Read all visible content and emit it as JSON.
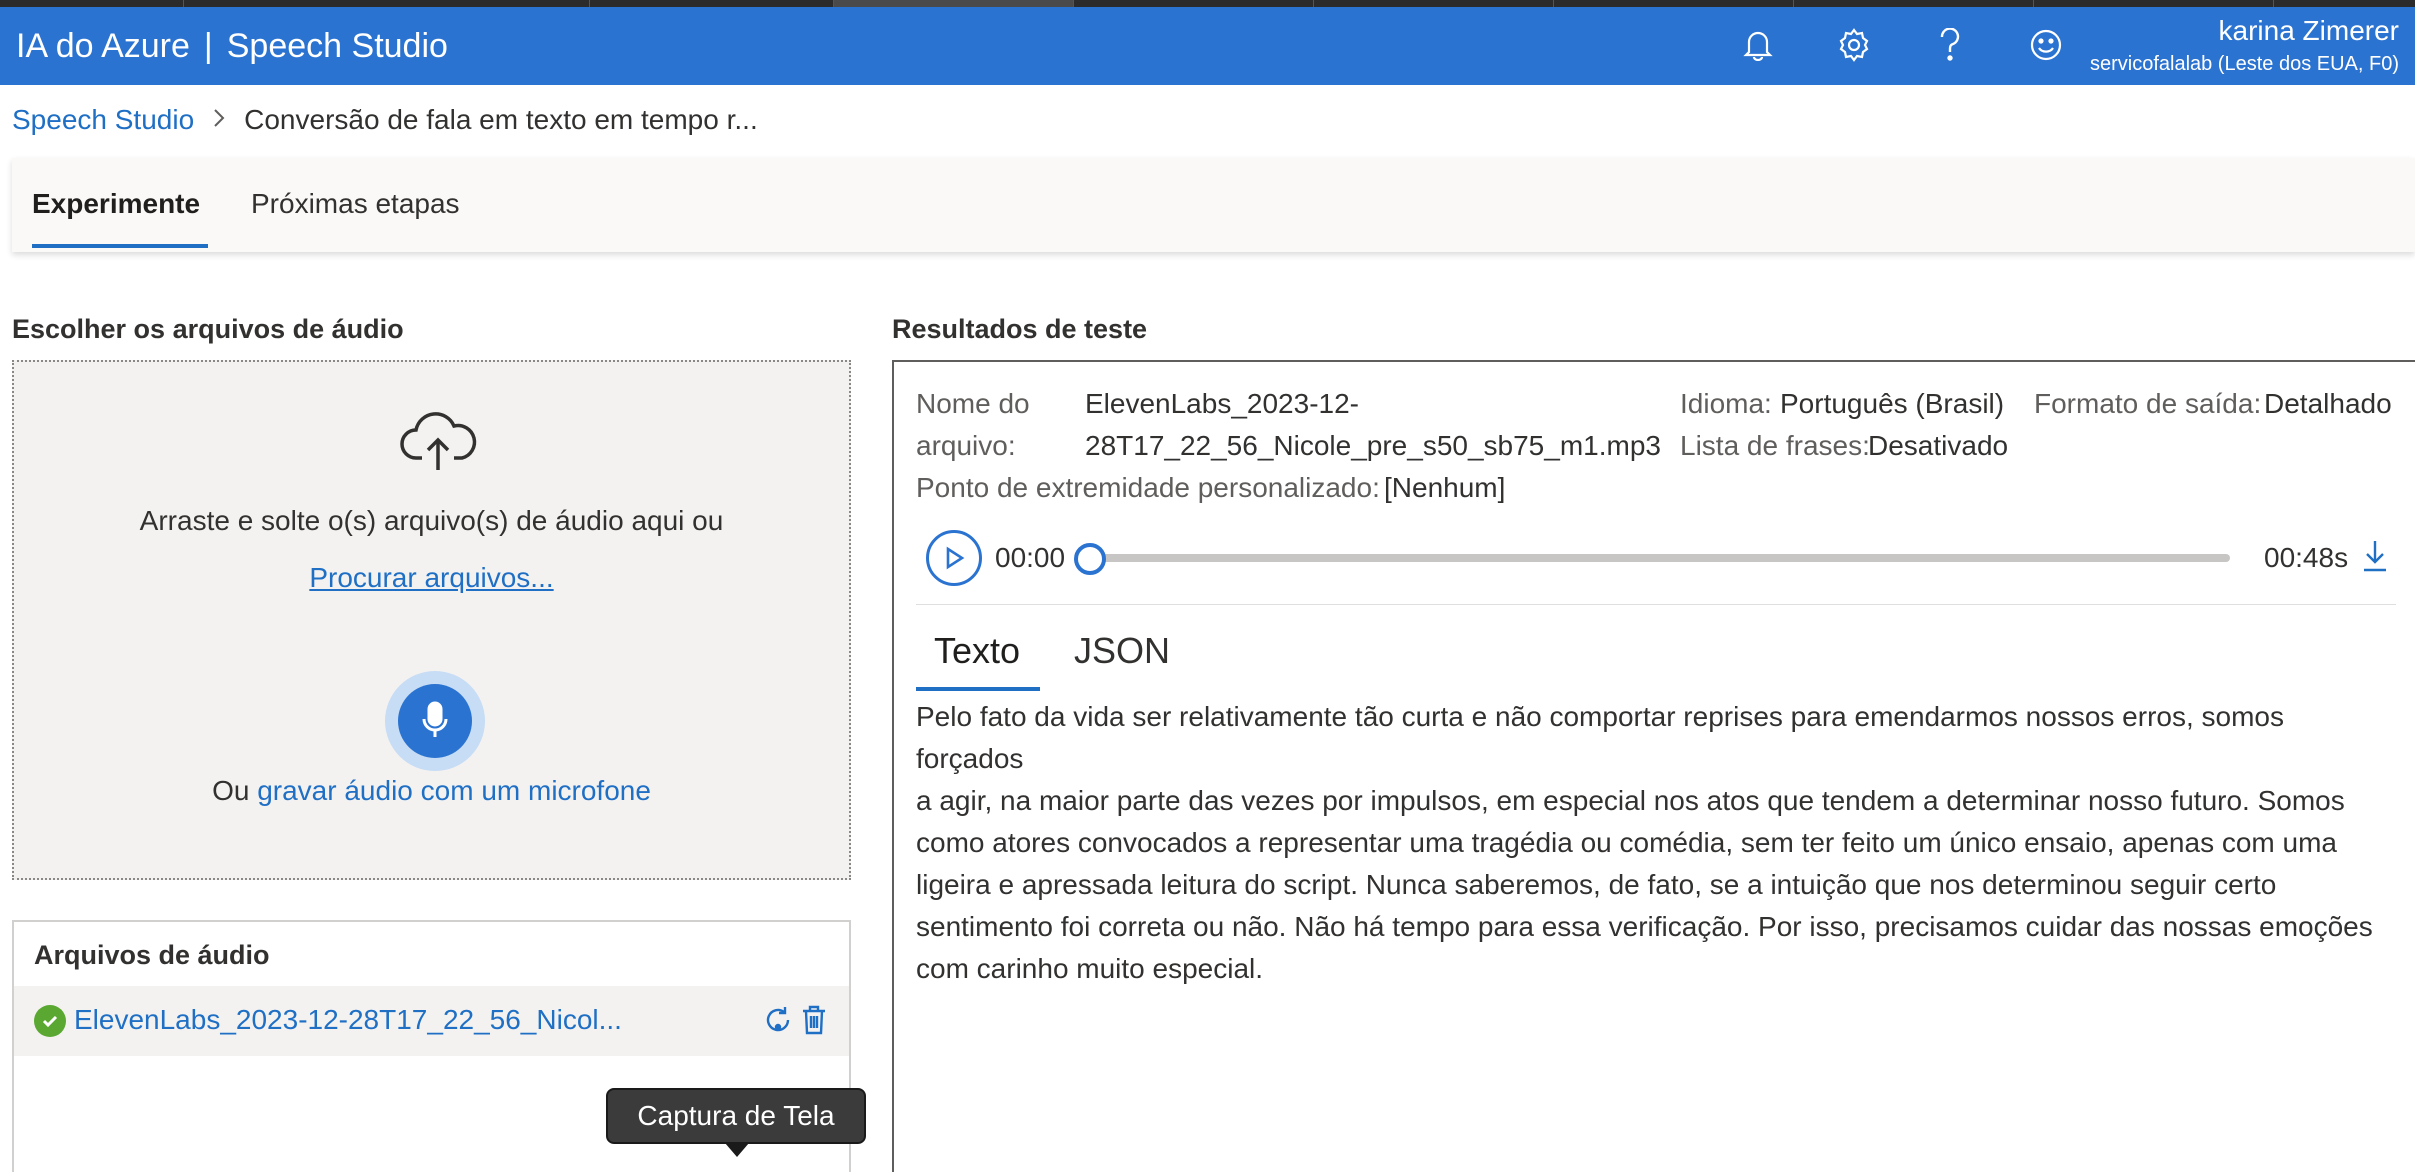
{
  "header": {
    "product": "IA do Azure",
    "separator": "|",
    "app": "Speech Studio",
    "user_name": "karina Zimerer",
    "user_subscription": "servicofalalab (Leste dos EUA, F0)"
  },
  "breadcrumb": {
    "root": "Speech Studio",
    "current": "Conversão de fala em texto em tempo r..."
  },
  "tabs": [
    {
      "label": "Experimente",
      "active": true
    },
    {
      "label": "Próximas etapas",
      "active": false
    }
  ],
  "upload": {
    "section_title": "Escolher os arquivos de áudio",
    "drag_text": "Arraste e solte o(s) arquivo(s) de áudio aqui ou",
    "browse_label": "Procurar arquivos...",
    "record_prefix": "Ou",
    "record_link": "gravar áudio com um microfone"
  },
  "files": {
    "title": "Arquivos de áudio",
    "items": [
      {
        "name": "ElevenLabs_2023-12-28T17_22_56_Nicol...",
        "status": "success"
      }
    ]
  },
  "tooltip": "Captura de Tela",
  "results": {
    "section_title": "Resultados de teste",
    "file_label_1": "Nome do",
    "file_label_2": "arquivo:",
    "file_value_1": "ElevenLabs_2023-12-",
    "file_value_2": "28T17_22_56_Nicole_pre_s50_sb75_m1.mp3",
    "language_label": "Idioma:",
    "language_value": "Português (Brasil)",
    "output_label": "Formato de saída:",
    "output_value": "Detalhado",
    "phrases_label": "Lista de frases:",
    "phrases_value": "Desativado",
    "endpoint_label": "Ponto de extremidade personalizado:",
    "endpoint_value": "[Nenhum]",
    "player": {
      "current_time": "00:00",
      "duration": "00:48s",
      "progress": 0
    },
    "tabs": [
      {
        "label": "Texto",
        "active": true
      },
      {
        "label": "JSON",
        "active": false
      }
    ],
    "transcript_lines": [
      "Pelo fato da vida ser relativamente tão curta e não comportar reprises para emendarmos nossos erros, somos forçados",
      "a agir, na maior parte das vezes por impulsos, em especial nos atos que tendem a determinar nosso futuro. Somos",
      "como atores convocados a representar uma tragédia ou comédia, sem ter feito um único ensaio, apenas com uma",
      "ligeira e apressada leitura do script. Nunca saberemos, de fato, se a intuição que nos determinou seguir certo",
      "sentimento foi correta ou não. Não há tempo para essa verificação. Por isso, precisamos cuidar das nossas emoções",
      "com carinho muito especial."
    ]
  },
  "icons": {
    "bell": "bell-icon",
    "settings": "gear-icon",
    "help": "help-icon",
    "feedback": "smiley-icon",
    "upload": "cloud-upload-icon",
    "mic": "microphone-icon",
    "success": "checkmark-circle-icon",
    "reprocess": "refresh-icon",
    "delete": "trash-icon",
    "play": "play-icon",
    "download": "download-icon"
  },
  "colors": {
    "header_bg": "#2b73d0",
    "link": "#1f6fc5",
    "success": "#5aa832"
  }
}
